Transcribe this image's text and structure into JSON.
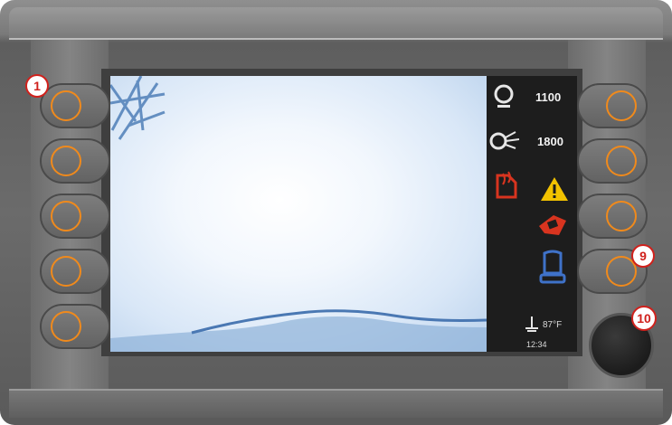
{
  "sidebar": {
    "engine_rpm": "1100",
    "fan_rpm": "1800",
    "temperature": "87°F",
    "clock": "12:34"
  },
  "callouts": [
    "1",
    "9",
    "10"
  ],
  "icons": [
    "engine-icon",
    "turbo-fan-icon",
    "heater-warning-icon",
    "warning-triangle-icon",
    "filter-warning-icon",
    "seat-icon",
    "thermometer-icon",
    "frost-icon"
  ],
  "colors": {
    "accent": "#f08a1c",
    "warning": "#f2c200",
    "alert": "#d8341f",
    "callout": "#d0211c"
  }
}
